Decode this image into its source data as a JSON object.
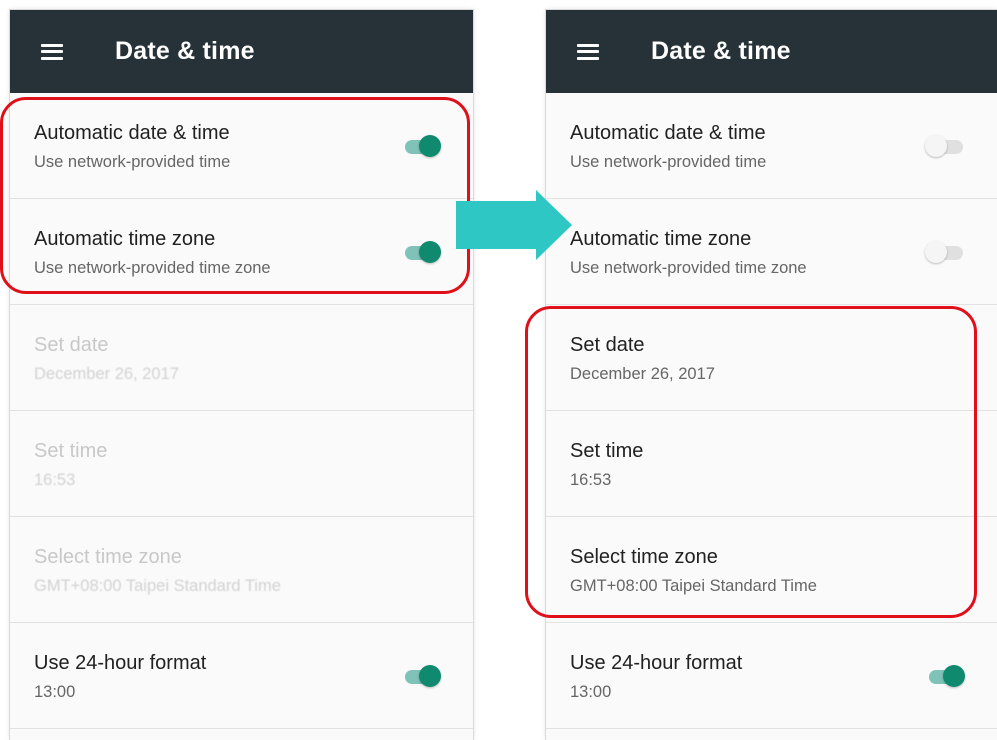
{
  "colors": {
    "appbar": "#263238",
    "toggle_on_thumb": "#0f8a6f",
    "toggle_on_track": "#7fc2b7",
    "highlight_red": "#e0101a",
    "arrow": "#2ec7c4"
  },
  "icons": {
    "menu": "hamburger-menu-icon",
    "arrow": "right-arrow-icon"
  },
  "left_screen": {
    "title": "Date & time",
    "rows": [
      {
        "title": "Automatic date & time",
        "summary": "Use network-provided time",
        "toggle": "on",
        "enabled": true
      },
      {
        "title": "Automatic time zone",
        "summary": "Use network-provided time zone",
        "toggle": "on",
        "enabled": true
      },
      {
        "title": "Set date",
        "summary": "December 26, 2017",
        "enabled": false
      },
      {
        "title": "Set time",
        "summary": "16:53",
        "enabled": false
      },
      {
        "title": "Select time zone",
        "summary": "GMT+08:00 Taipei Standard Time",
        "enabled": false
      },
      {
        "title": "Use 24-hour format",
        "summary": "13:00",
        "toggle": "on",
        "enabled": true
      }
    ]
  },
  "right_screen": {
    "title": "Date & time",
    "rows": [
      {
        "title": "Automatic date & time",
        "summary": "Use network-provided time",
        "toggle": "off",
        "enabled": true
      },
      {
        "title": "Automatic time zone",
        "summary": "Use network-provided time zone",
        "toggle": "off",
        "enabled": true
      },
      {
        "title": "Set date",
        "summary": "December 26, 2017",
        "enabled": true
      },
      {
        "title": "Set time",
        "summary": "16:53",
        "enabled": true
      },
      {
        "title": "Select time zone",
        "summary": "GMT+08:00 Taipei Standard Time",
        "enabled": true
      },
      {
        "title": "Use 24-hour format",
        "summary": "13:00",
        "toggle": "on",
        "enabled": true
      }
    ]
  }
}
